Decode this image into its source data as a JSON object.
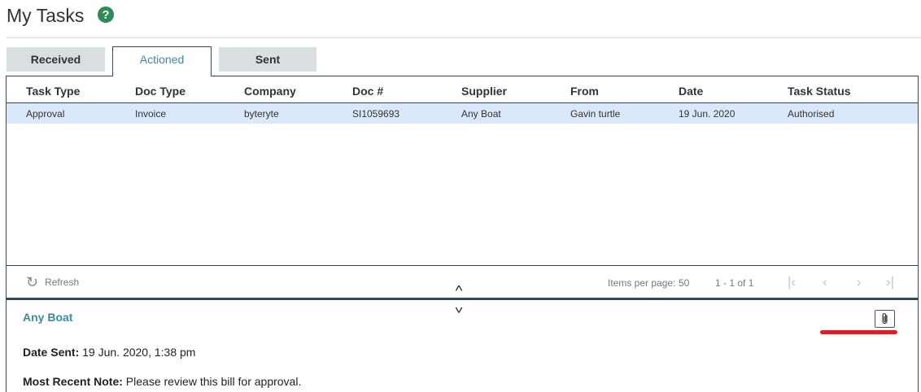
{
  "page": {
    "title": "My Tasks",
    "help_icon": "?"
  },
  "tabs": [
    {
      "label": "Received",
      "active": false
    },
    {
      "label": "Actioned",
      "active": true
    },
    {
      "label": "Sent",
      "active": false
    }
  ],
  "table": {
    "columns": [
      "Task Type",
      "Doc Type",
      "Company",
      "Doc #",
      "Supplier",
      "From",
      "Date",
      "Task Status"
    ],
    "rows": [
      [
        "Approval",
        "Invoice",
        "byteryte",
        "SI1059693",
        "Any Boat",
        "Gavin turtle",
        "19 Jun. 2020",
        "Authorised"
      ]
    ],
    "selected_row_color": "#dbe8fb"
  },
  "footer": {
    "refresh_label": "Refresh",
    "items_per_page_label": "Items per page:",
    "items_per_page_value": "50",
    "range": "1 - 1 of 1"
  },
  "detail": {
    "title": "Any Boat",
    "date_sent_label": "Date Sent:",
    "date_sent_value": "19 Jun. 2020, 1:38 pm",
    "note_label": "Most Recent Note:",
    "note_value": "Please review this bill for approval."
  },
  "colors": {
    "accent": "#3b8a9e",
    "border": "#2e4a5b",
    "help": "#2e8b57",
    "highlight_mark": "#e11d21"
  }
}
